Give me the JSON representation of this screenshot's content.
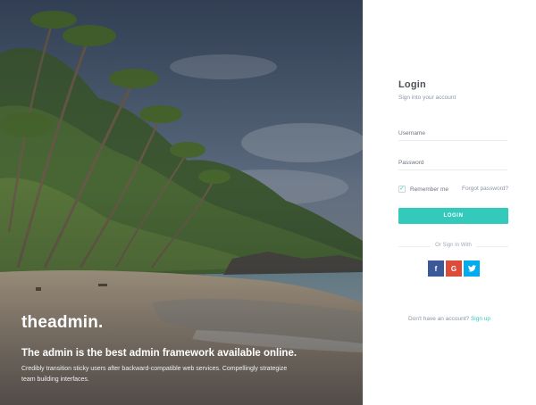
{
  "hero": {
    "brand": "theadmin.",
    "tagline": "The admin is the best admin framework available online.",
    "description": "Credibly transition sticky users after backward-compatible web services. Compellingly strategize team building interfaces."
  },
  "login": {
    "title": "Login",
    "subtitle": "Sign into your account",
    "username_placeholder": "Username",
    "password_placeholder": "Password",
    "remember_label": "Remember me",
    "remember_checked": true,
    "forgot_label": "Forgot password?",
    "login_button": "LOGIN",
    "social_divider": "Or Sign In With",
    "social": [
      {
        "icon": "facebook-icon",
        "glyph": "f",
        "color": "#3b5998"
      },
      {
        "icon": "google-plus-icon",
        "glyph": "G",
        "color": "#dd4b39"
      },
      {
        "icon": "twitter-icon",
        "glyph": "t",
        "color": "#00aced"
      }
    ],
    "signup_prompt": "Don't have an account?",
    "signup_link": "Sign up"
  },
  "colors": {
    "accent": "#33cabb",
    "text": "#4d5259",
    "muted": "#8b95a5"
  }
}
